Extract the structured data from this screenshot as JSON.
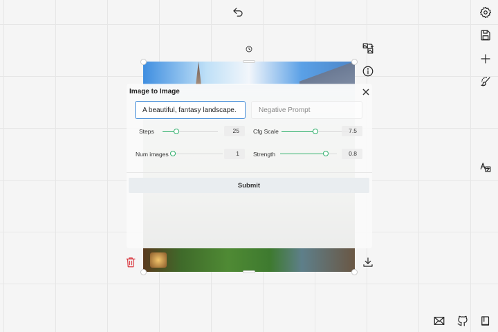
{
  "dialog": {
    "title": "Image to Image",
    "prompt_value": "A beautiful, fantasy landscape.",
    "negative_placeholder": "Negative Prompt",
    "steps": {
      "label": "Steps",
      "value": "25",
      "fraction": 0.25
    },
    "cfg_scale": {
      "label": "Cfg Scale",
      "value": "7.5",
      "fraction": 0.5
    },
    "num_images": {
      "label": "Num images",
      "value": "1",
      "fraction": 0.0
    },
    "strength": {
      "label": "Strength",
      "value": "0.8",
      "fraction": 0.8
    },
    "submit_label": "Submit"
  },
  "colors": {
    "accent": "#2eaf6b",
    "focus_border": "#4a90d9",
    "delete": "#d9363e"
  },
  "icons": {
    "top": "undo-icon",
    "canvas_rotate": "rotate-icon",
    "right_toolbar": [
      "settings-icon",
      "save-icon",
      "plus-icon",
      "brush-icon",
      "translate-icon"
    ],
    "canvas_side": [
      "image-to-image-icon",
      "info-icon",
      "download-icon",
      "trash-icon"
    ],
    "bottom_right": [
      "mail-icon",
      "github-icon",
      "book-icon"
    ]
  }
}
